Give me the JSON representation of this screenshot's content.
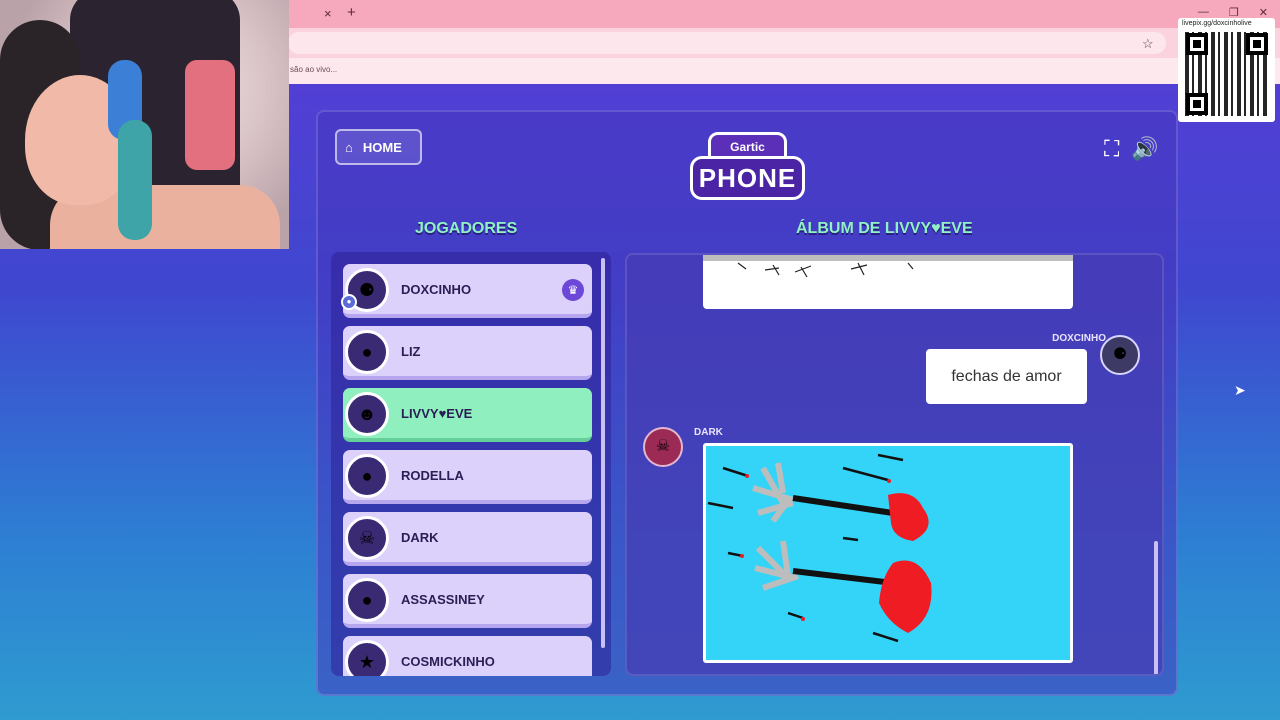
{
  "browser": {
    "tab_close": "×",
    "tab_new": "+",
    "bookmark_text": "são ao vivo..."
  },
  "qr": {
    "label": "livepix.gg/doxcinholive"
  },
  "game": {
    "home_label": "HOME",
    "logo_top": "Gartic",
    "logo_main": "PHONE",
    "players_heading": "JOGADORES",
    "album_heading": "ÁLBUM DE LIVVY♥EVE",
    "players": [
      {
        "name": "DOXCINHO",
        "avatar": "⚈",
        "host": true,
        "active": false
      },
      {
        "name": "LIZ",
        "avatar": "●",
        "host": false,
        "active": false
      },
      {
        "name": "LIVVY♥EVE",
        "avatar": "☻",
        "host": false,
        "active": true
      },
      {
        "name": "RODELLA",
        "avatar": "●",
        "host": false,
        "active": false
      },
      {
        "name": "DARK",
        "avatar": "☠",
        "host": false,
        "active": false
      },
      {
        "name": "ASSASSINEY",
        "avatar": "●",
        "host": false,
        "active": false
      },
      {
        "name": "COSMICKINHO",
        "avatar": "★",
        "host": false,
        "active": false
      }
    ],
    "album": {
      "message_author": "DOXCINHO",
      "message_text": "fechas de amor",
      "drawing_author": "DARK"
    }
  },
  "colors": {
    "heading": "#8ff2c2",
    "active_player": "#90efbf",
    "drawing_bg": "#33d4f7"
  }
}
